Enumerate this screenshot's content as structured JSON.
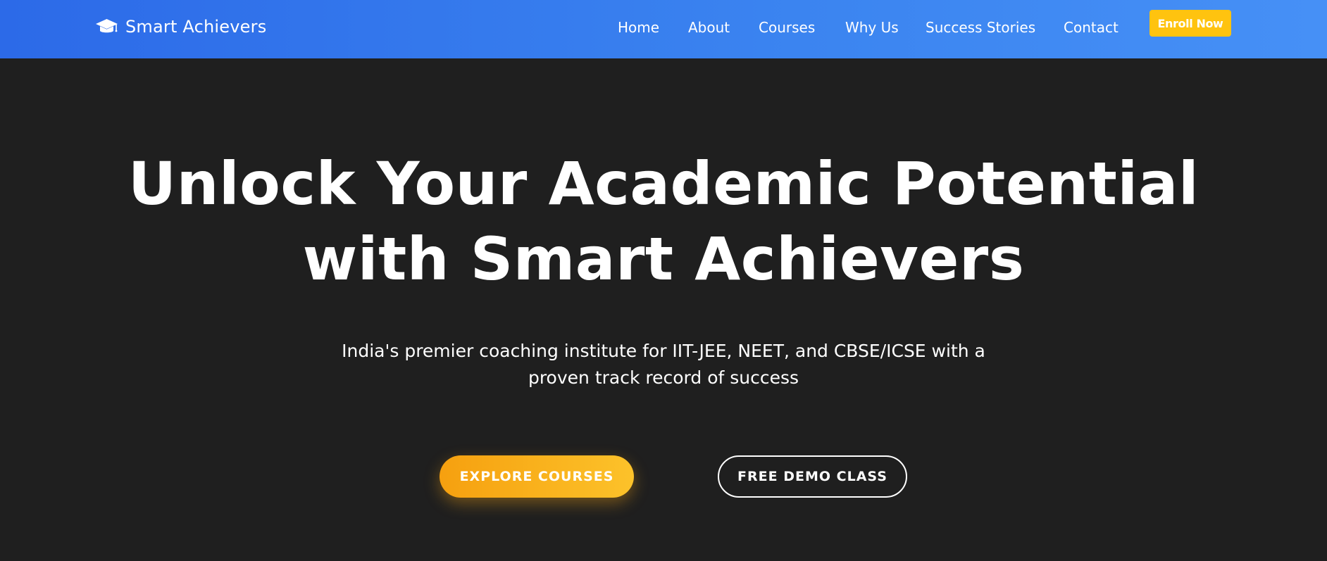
{
  "header": {
    "brand": {
      "icon": "graduation-cap-icon",
      "name": "Smart Achievers"
    },
    "nav": [
      {
        "label": "Home"
      },
      {
        "label": "About"
      },
      {
        "label": "Courses"
      },
      {
        "label": "Why Us"
      },
      {
        "label": "Success Stories"
      },
      {
        "label": "Contact"
      }
    ],
    "cta_label": "Enroll Now"
  },
  "hero": {
    "title_line1": "Unlock Your Academic Potential",
    "title_line2": "with Smart Achievers",
    "subtitle_line1": "India's premier coaching institute for IIT-JEE, NEET, and CBSE/ICSE with a",
    "subtitle_line2": "proven track record of success",
    "primary_button": "EXPLORE COURSES",
    "secondary_button": "FREE DEMO CLASS"
  },
  "colors": {
    "header_gradient_start": "#2c6ae8",
    "header_gradient_end": "#4690f6",
    "hero_background": "#1f1f1f",
    "accent_yellow": "#ffc30f",
    "accent_orange": "#f6a00f",
    "text": "#ffffff"
  }
}
